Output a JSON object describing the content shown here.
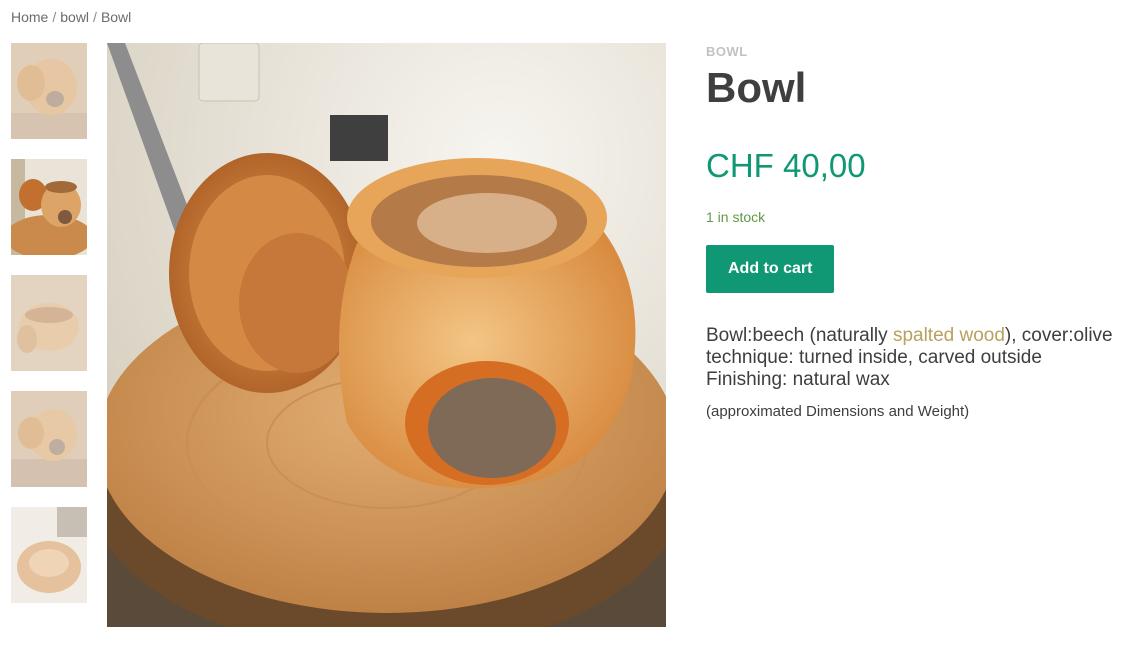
{
  "breadcrumb": {
    "home": "Home",
    "category": "bowl",
    "current": "Bowl",
    "separator": "/"
  },
  "product": {
    "category": "BOWL",
    "title": "Bowl",
    "price": "CHF 40,00",
    "stock": "1 in stock",
    "add_to_cart": "Add to cart",
    "description": {
      "line1_before": "Bowl:beech (naturally ",
      "line1_link": "spalted wood",
      "line1_after": "), cover:olive",
      "line2": "technique: turned inside, carved outside",
      "line3": "Finishing: natural wax"
    },
    "dimensions_note": "(approximated Dimensions and Weight)"
  },
  "colors": {
    "accent": "#0f9873",
    "stock": "#5f9a45",
    "link": "#b8a05e"
  },
  "gallery": {
    "thumbnail_count": 5,
    "active_index": 1
  }
}
